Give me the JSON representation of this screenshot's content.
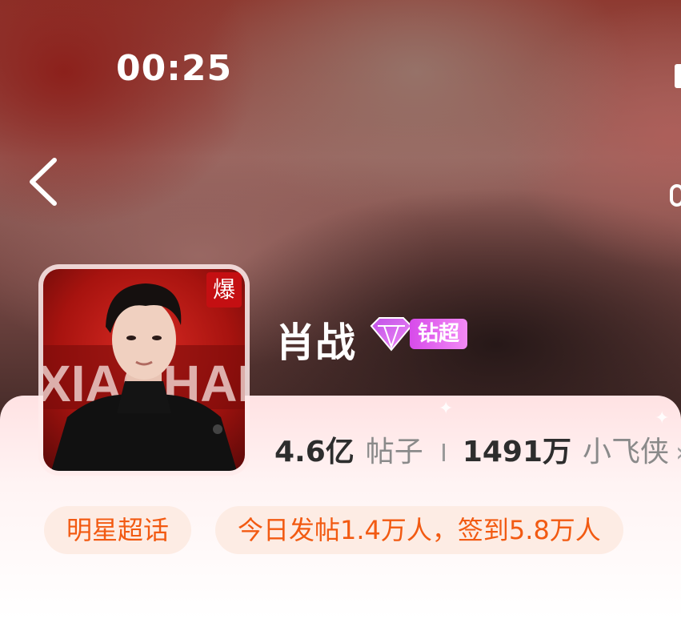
{
  "status_bar": {
    "time": "00:25"
  },
  "topic": {
    "name": "肖战",
    "tier_label": "钻超",
    "hot_badge": "爆"
  },
  "stats": {
    "posts_count": "4.6",
    "posts_unit": "亿",
    "posts_label": "帖子",
    "fans_count": "1491",
    "fans_unit": "万",
    "fans_label": "小飞侠",
    "more_icon": "chevron-right-icon"
  },
  "tags": [
    {
      "label": "明星超话"
    },
    {
      "label": "今日发帖1.4万人，签到5.8万人"
    }
  ],
  "colors": {
    "accent_orange": "#f25a12",
    "tag_bg": "#fdece4",
    "tier_purple": "#d74bea",
    "hot_red": "#c40f12"
  }
}
